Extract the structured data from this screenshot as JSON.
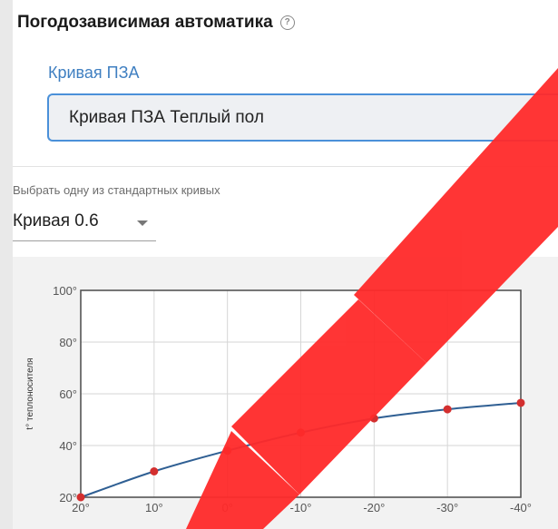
{
  "weather_automation": {
    "title": "Погодозависимая автоматика",
    "help_icon": "question-circle-icon",
    "curve_field": {
      "label": "Кривая ПЗА",
      "value": "Кривая ПЗА Теплый пол"
    },
    "standard_curves": {
      "hint": "Выбрать одну из стандартных кривых",
      "selected": "Кривая 0.6"
    }
  },
  "colors": {
    "accent": "#4a90d9",
    "label_blue": "#3f7fc1",
    "curve": "#2f5f93",
    "point": "#d32f2f",
    "watermark": "#ff2020"
  },
  "chart_data": {
    "type": "line",
    "ylabel": "t° теплоносителя",
    "x_ticks": [
      "20°",
      "10°",
      "0°",
      "-10°",
      "-20°",
      "-30°",
      "-40°"
    ],
    "y_ticks": [
      "20°",
      "40°",
      "60°",
      "80°",
      "100°"
    ],
    "x": [
      20,
      10,
      0,
      -10,
      -20,
      -30,
      -40
    ],
    "series": [
      {
        "values": [
          20,
          30,
          38,
          45,
          50.5,
          54,
          56.5
        ]
      }
    ],
    "xlim": [
      20,
      -40
    ],
    "ylim": [
      20,
      100
    ],
    "grid": true
  }
}
